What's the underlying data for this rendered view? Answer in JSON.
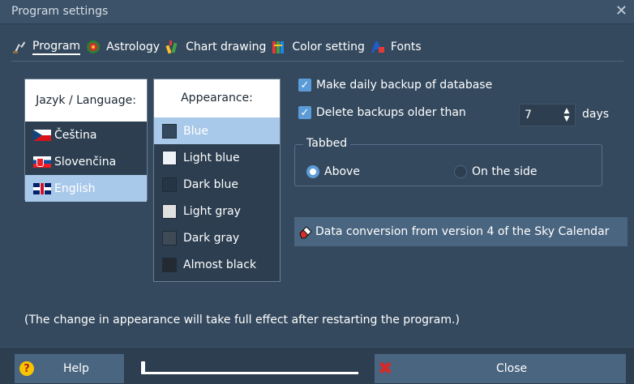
{
  "window": {
    "title": "Program settings",
    "close_glyph": "✕"
  },
  "tabs": [
    {
      "label": "Program",
      "icon": "program-icon",
      "active": true
    },
    {
      "label": "Astrology",
      "icon": "astrology-icon",
      "active": false
    },
    {
      "label": "Chart drawing",
      "icon": "chart-drawing-icon",
      "active": false
    },
    {
      "label": "Color setting",
      "icon": "color-setting-icon",
      "active": false
    },
    {
      "label": "Fonts",
      "icon": "fonts-icon",
      "active": false
    }
  ],
  "language": {
    "header": "Jazyk / Language:",
    "items": [
      {
        "label": "Čeština",
        "flag": "czech-flag-icon",
        "selected": false
      },
      {
        "label": "Slovenčina",
        "flag": "slovak-flag-icon",
        "selected": false
      },
      {
        "label": "English",
        "flag": "uk-flag-icon",
        "selected": true
      }
    ]
  },
  "appearance": {
    "header": "Appearance:",
    "items": [
      {
        "label": "Blue",
        "swatch": "#34495e",
        "selected": true
      },
      {
        "label": "Light blue",
        "swatch": "#eef3f8",
        "selected": false
      },
      {
        "label": "Dark blue",
        "swatch": "#263545",
        "selected": false
      },
      {
        "label": "Light gray",
        "swatch": "#e0e0e0",
        "selected": false
      },
      {
        "label": "Dark gray",
        "swatch": "#3e4a55",
        "selected": false
      },
      {
        "label": "Almost black",
        "swatch": "#232a31",
        "selected": false
      }
    ]
  },
  "options": {
    "daily_backup": {
      "label": "Make daily backup of database",
      "checked": true
    },
    "delete_backups": {
      "label": "Delete backups older than",
      "checked": true
    },
    "days_value": "7",
    "days_label": "days",
    "check_glyph": "✓",
    "spin_up": "▲",
    "spin_down": "▼"
  },
  "tabbed": {
    "legend": "Tabbed",
    "above": {
      "label": "Above",
      "selected": true
    },
    "side": {
      "label": "On the side",
      "selected": false
    }
  },
  "conversion_button": {
    "label": "Data conversion from version 4 of the Sky Calendar"
  },
  "note": "(The change in appearance will take full effect after restarting the program.)",
  "footer": {
    "help_label": "Help",
    "help_glyph": "?",
    "close_label": "Close",
    "close_glyph": "✖",
    "slider_value": 0
  },
  "colors": {
    "background": "#34495e",
    "accent": "#5b9bd8",
    "selected_row": "#a9c9ea"
  }
}
